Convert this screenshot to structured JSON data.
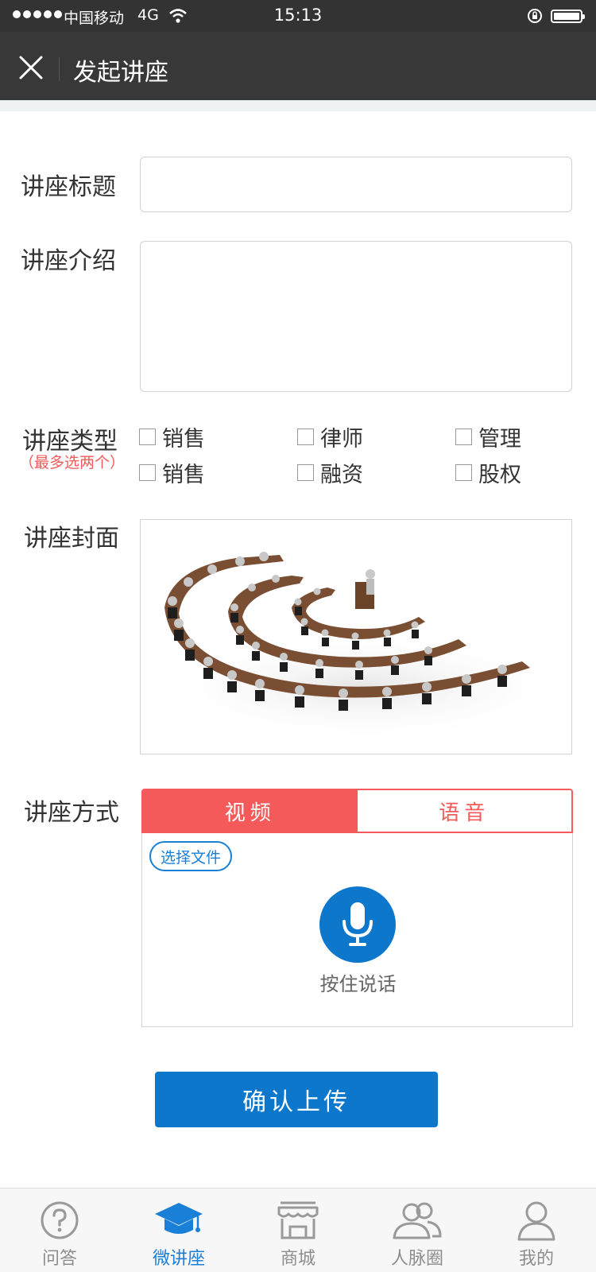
{
  "status_bar": {
    "carrier": "中国移动",
    "network": "4G",
    "time": "15:13"
  },
  "nav": {
    "title": "发起讲座"
  },
  "form": {
    "title_label": "讲座标题",
    "title_value": "",
    "intro_label": "讲座介绍",
    "intro_value": "",
    "type_label": "讲座类型",
    "type_hint": "（最多选两个）",
    "type_options": [
      {
        "label": "销售",
        "checked": false
      },
      {
        "label": "律师",
        "checked": false
      },
      {
        "label": "管理",
        "checked": false
      },
      {
        "label": "销售",
        "checked": false
      },
      {
        "label": "融资",
        "checked": false
      },
      {
        "label": "股权",
        "checked": false
      }
    ],
    "cover_label": "讲座封面",
    "mode_label": "讲座方式",
    "mode_tabs": [
      {
        "label": "视频",
        "active": true
      },
      {
        "label": "语音",
        "active": false
      }
    ],
    "select_file": "选择文件",
    "hold_to_talk": "按住说话",
    "submit": "确认上传"
  },
  "tabbar": {
    "items": [
      {
        "label": "问答",
        "icon": "question-icon",
        "active": false
      },
      {
        "label": "微讲座",
        "icon": "graduation-cap-icon",
        "active": true
      },
      {
        "label": "商城",
        "icon": "shop-icon",
        "active": false
      },
      {
        "label": "人脉圈",
        "icon": "contacts-icon",
        "active": false
      },
      {
        "label": "我的",
        "icon": "user-icon",
        "active": false
      }
    ]
  },
  "colors": {
    "accent_blue": "#0d77cc",
    "accent_red": "#f55a5a",
    "navbar": "#383838"
  }
}
